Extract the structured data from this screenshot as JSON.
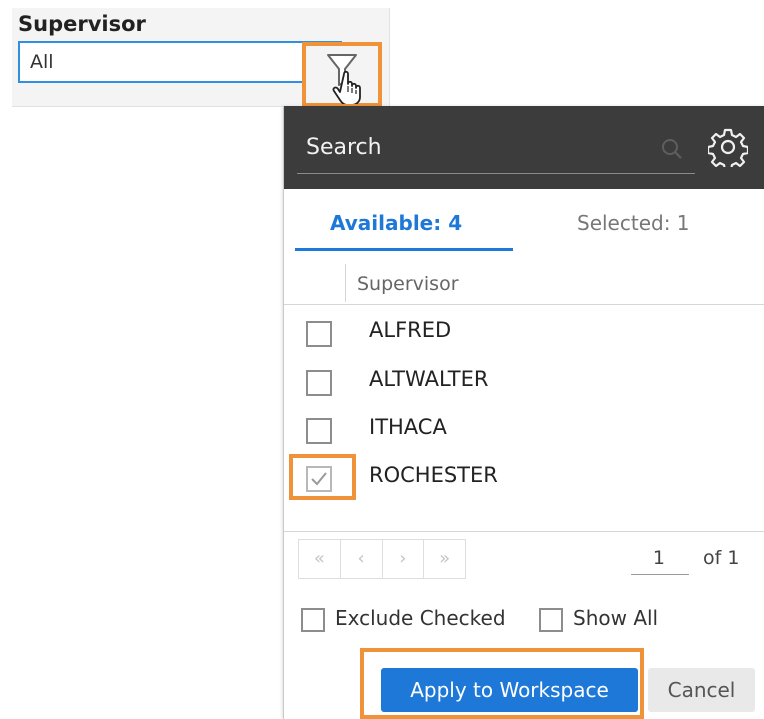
{
  "filter": {
    "title": "Supervisor",
    "value": "All"
  },
  "popup": {
    "search_placeholder": "Search",
    "tabs": {
      "available": "Available: 4",
      "selected": "Selected: 1"
    },
    "column_header": "Supervisor",
    "items": [
      {
        "label": "ALFRED",
        "checked": false
      },
      {
        "label": "ALTWALTER",
        "checked": false
      },
      {
        "label": "ITHACA",
        "checked": false
      },
      {
        "label": "ROCHESTER",
        "checked": true
      }
    ],
    "pager": {
      "first": "«",
      "prev": "‹",
      "next": "›",
      "last": "»",
      "page": "1",
      "of_label": "of 1"
    },
    "options": {
      "exclude_checked": "Exclude Checked",
      "show_all": "Show All"
    },
    "buttons": {
      "apply": "Apply to Workspace",
      "cancel": "Cancel"
    }
  },
  "colors": {
    "accent": "#1e78d8",
    "highlight": "#f0923a",
    "header_bg": "#3c3c3c"
  },
  "icons": [
    "filter-icon",
    "hand-cursor-icon",
    "search-icon",
    "gear-icon",
    "checkmark-icon"
  ]
}
